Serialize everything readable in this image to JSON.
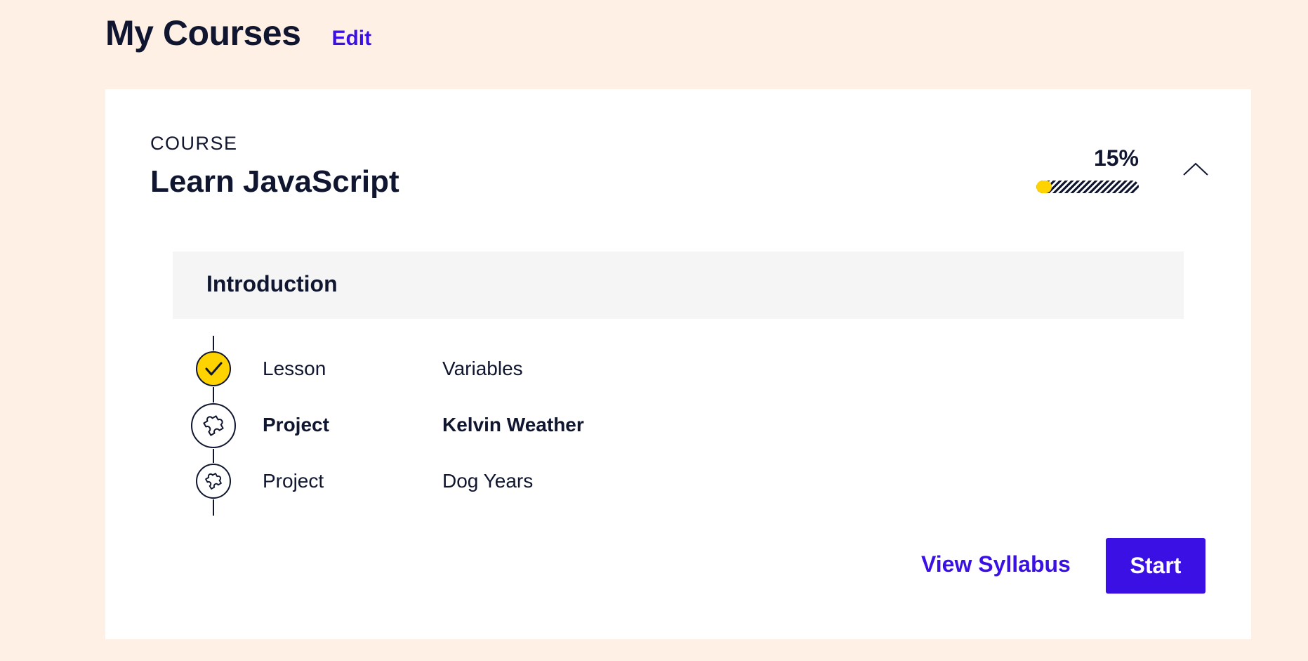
{
  "header": {
    "title": "My Courses",
    "edit_label": "Edit"
  },
  "course": {
    "kicker": "COURSE",
    "title": "Learn JavaScript",
    "progress_label": "15%",
    "progress_fraction": 0.15,
    "section": {
      "title": "Introduction",
      "items": [
        {
          "type": "Lesson",
          "name": "Variables",
          "status": "completed",
          "icon": "check-icon"
        },
        {
          "type": "Project",
          "name": "Kelvin Weather",
          "status": "current",
          "icon": "puzzle-icon"
        },
        {
          "type": "Project",
          "name": "Dog Years",
          "status": "not-started",
          "icon": "puzzle-icon"
        }
      ]
    },
    "actions": {
      "view_syllabus_label": "View Syllabus",
      "start_label": "Start"
    }
  },
  "colors": {
    "page_background": "#fff0e6",
    "accent": "#3a10e5",
    "progress": "#ffd300",
    "text": "#10162f"
  }
}
